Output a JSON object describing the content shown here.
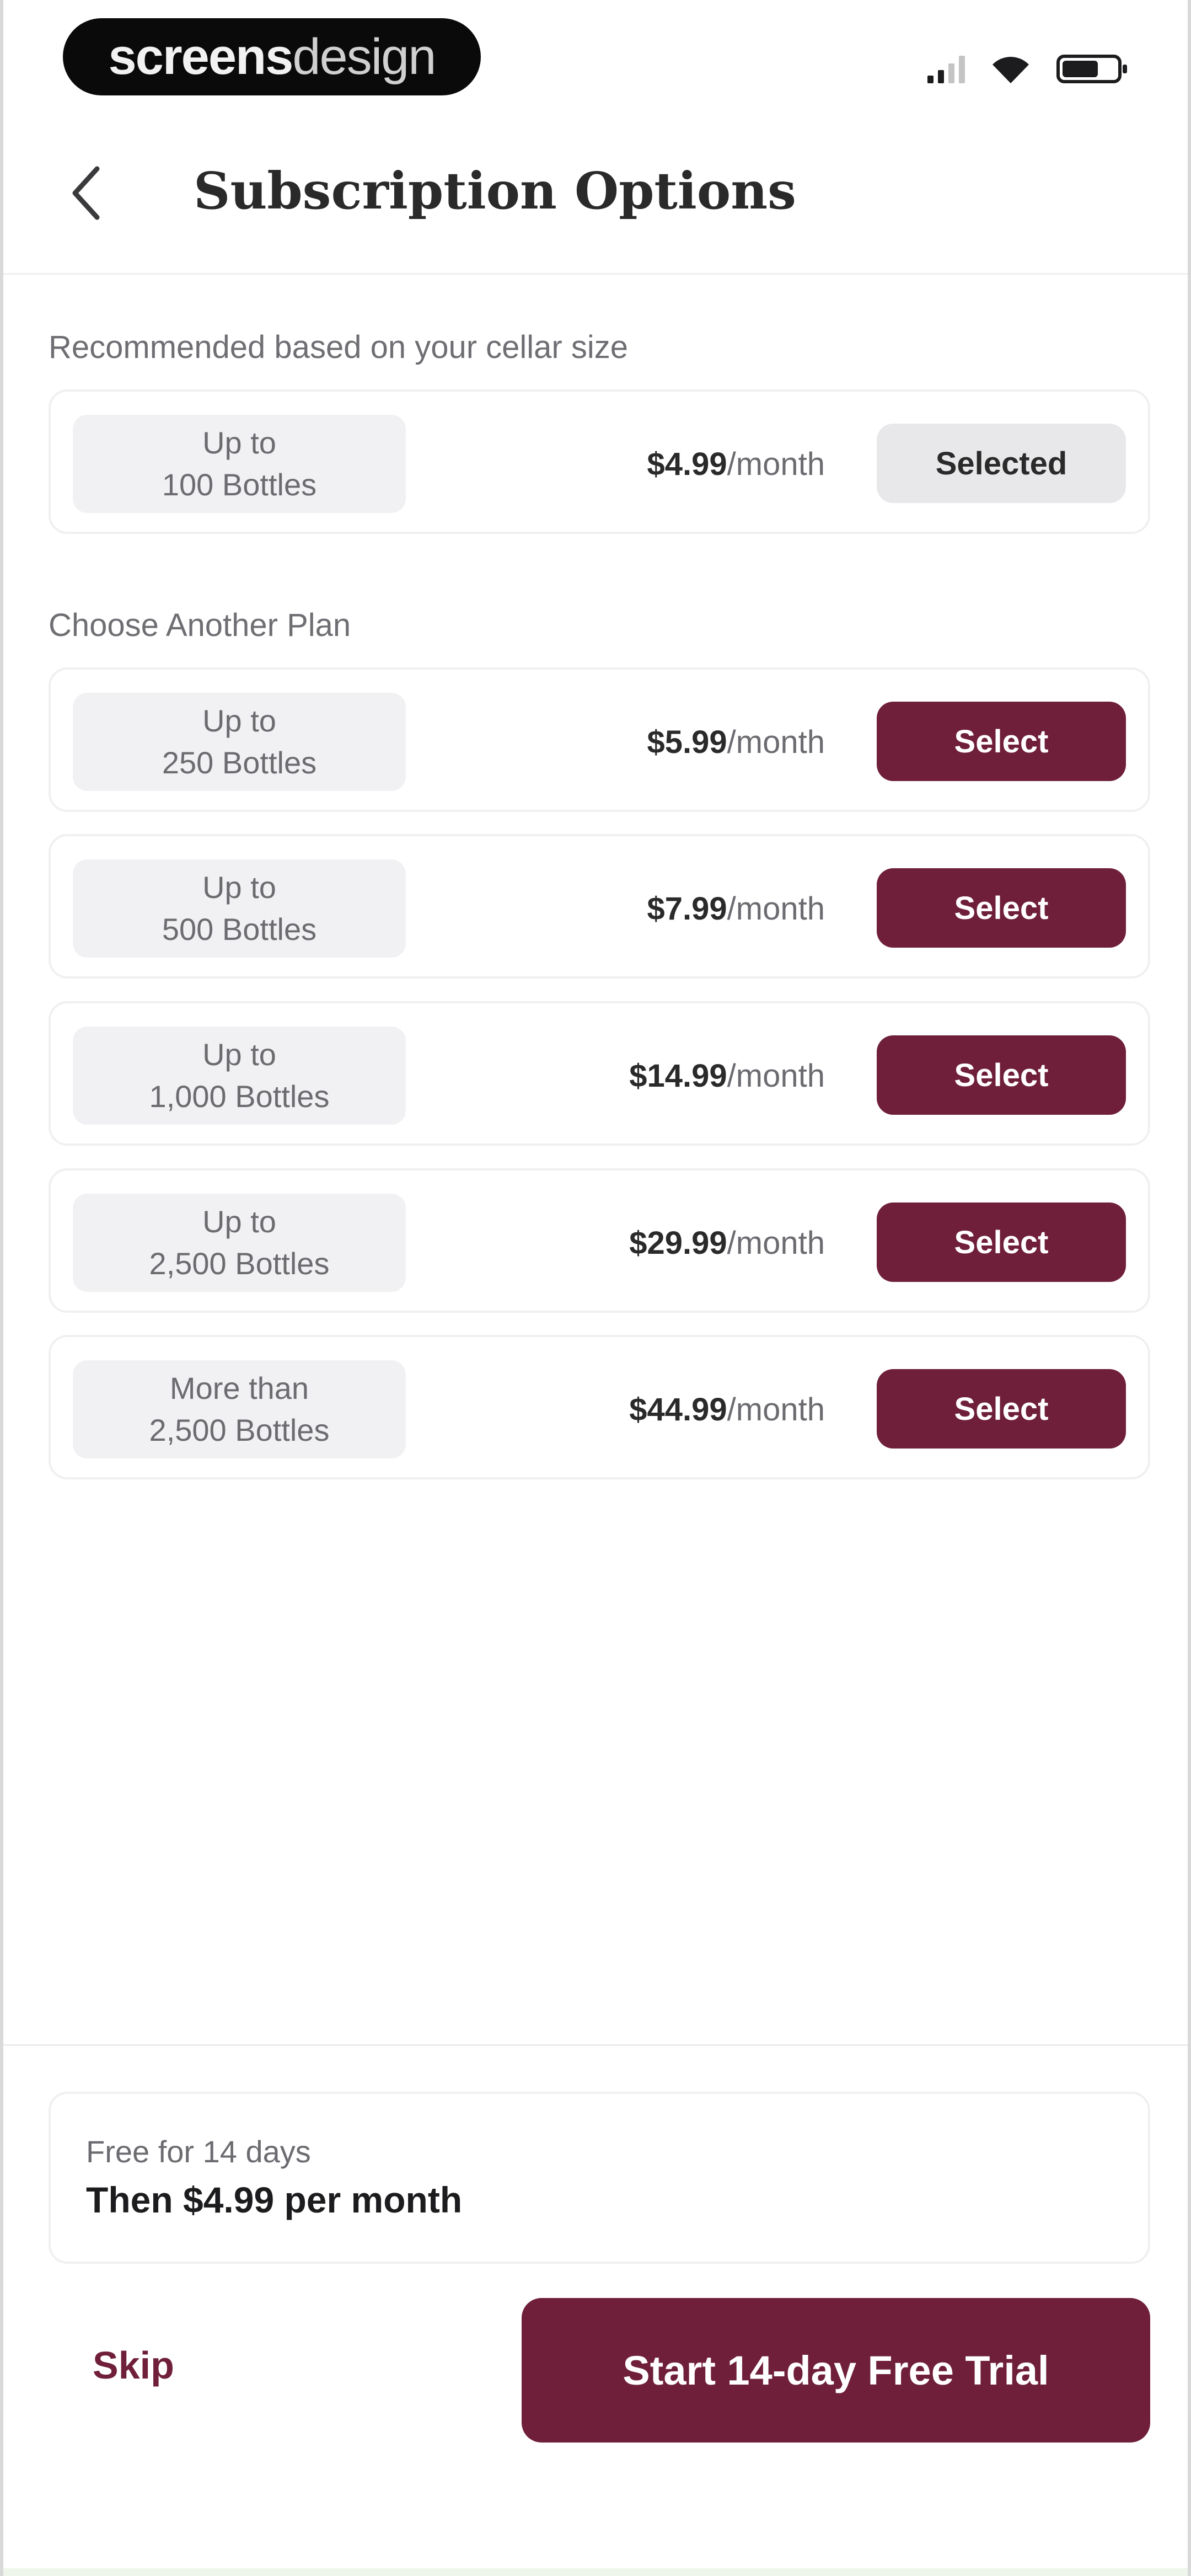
{
  "status_bar": {
    "brand_bold": "screens",
    "brand_light": "design",
    "icons": [
      "cellular-signal-icon",
      "wifi-icon",
      "battery-icon"
    ]
  },
  "header": {
    "back_icon": "chevron-left-icon",
    "title": "Subscription Options"
  },
  "recommended": {
    "label": "Recommended based on your cellar size",
    "plan": {
      "tag_line1": "Up to",
      "tag_line2": "100 Bottles",
      "price": "$4.99",
      "period": "/month",
      "button": "Selected"
    }
  },
  "other_plans": {
    "label": "Choose Another Plan",
    "plans": [
      {
        "tag_line1": "Up to",
        "tag_line2": "250 Bottles",
        "price": "$5.99",
        "period": "/month",
        "button": "Select"
      },
      {
        "tag_line1": "Up to",
        "tag_line2": "500 Bottles",
        "price": "$7.99",
        "period": "/month",
        "button": "Select"
      },
      {
        "tag_line1": "Up to",
        "tag_line2": "1,000 Bottles",
        "price": "$14.99",
        "period": "/month",
        "button": "Select"
      },
      {
        "tag_line1": "Up to",
        "tag_line2": "2,500 Bottles",
        "price": "$29.99",
        "period": "/month",
        "button": "Select"
      },
      {
        "tag_line1": "More than",
        "tag_line2": "2,500 Bottles",
        "price": "$44.99",
        "period": "/month",
        "button": "Select"
      }
    ]
  },
  "trial": {
    "note": "Free for 14 days",
    "price_line": "Then $4.99 per month"
  },
  "actions": {
    "skip": "Skip",
    "cta": "Start 14-day Free Trial"
  },
  "colors": {
    "accent": "#6f1f3a",
    "selected_button": "#e8e8ea",
    "tag_background": "#f1f1f3"
  }
}
